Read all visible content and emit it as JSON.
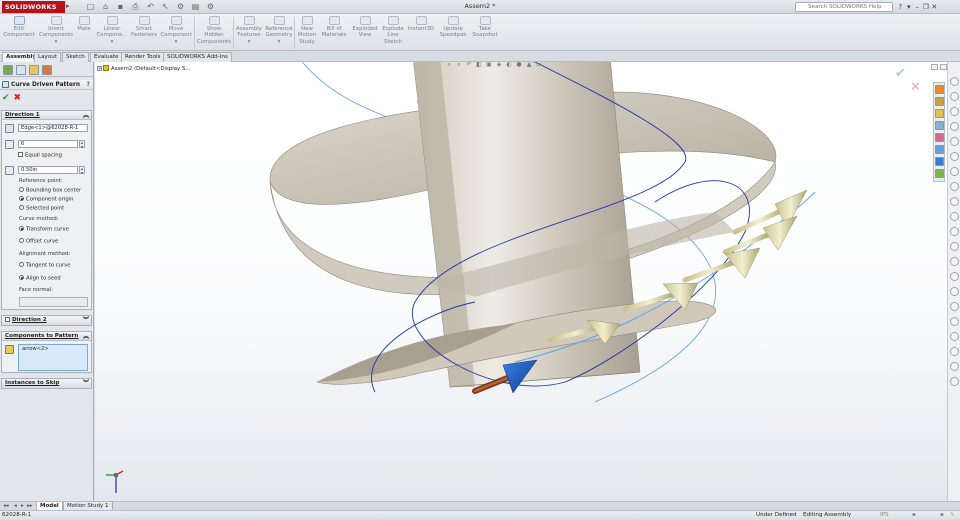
{
  "app": {
    "brand": "SOLIDWORKS",
    "document_title": "Assem2 *",
    "search_placeholder": "Search SOLIDWORKS Help",
    "accent": "#b5121b"
  },
  "ribbon": {
    "buttons": [
      {
        "label1": "Edit",
        "label2": "Component",
        "label3": ""
      },
      {
        "label1": "Insert",
        "label2": "Components",
        "label3": ""
      },
      {
        "label1": "Mate",
        "label2": "",
        "label3": ""
      },
      {
        "label1": "Linear",
        "label2": "Compone...",
        "label3": ""
      },
      {
        "label1": "Smart",
        "label2": "Fasteners",
        "label3": ""
      },
      {
        "label1": "Move",
        "label2": "Component",
        "label3": ""
      },
      {
        "label1": "Show",
        "label2": "Hidden",
        "label3": "Components"
      },
      {
        "label1": "Assembly",
        "label2": "Features",
        "label3": ""
      },
      {
        "label1": "Reference",
        "label2": "Geometry",
        "label3": ""
      },
      {
        "label1": "New",
        "label2": "Motion",
        "label3": "Study"
      },
      {
        "label1": "Bill of",
        "label2": "Materials",
        "label3": ""
      },
      {
        "label1": "Exploded",
        "label2": "View",
        "label3": ""
      },
      {
        "label1": "Explode",
        "label2": "Line",
        "label3": "Sketch"
      },
      {
        "label1": "Instant3D",
        "label2": "",
        "label3": ""
      },
      {
        "label1": "Update",
        "label2": "Speedpak",
        "label3": ""
      },
      {
        "label1": "Take",
        "label2": "Snapshot",
        "label3": ""
      }
    ]
  },
  "tabs": [
    "Assembly",
    "Layout",
    "Sketch",
    "Evaluate",
    "Render Tools",
    "SOLIDWORKS Add-Ins"
  ],
  "property_manager": {
    "title": "Curve Driven Pattern",
    "direction1": {
      "header": "Direction 1",
      "edge": "Edge<1>@62028-R-1",
      "instances": "6",
      "equal_spacing": "Equal spacing",
      "spacing": "0.50in",
      "reference_point_label": "Reference point:",
      "reference_options": [
        "Bounding box center",
        "Component origin",
        "Selected point"
      ],
      "reference_selected": 1,
      "curve_method_label": "Curve method:",
      "curve_options": [
        "Transform curve",
        "Offset curve"
      ],
      "curve_selected": 0,
      "alignment_label": "Alignment method:",
      "alignment_options": [
        "Tangent to curve",
        "Align to seed"
      ],
      "alignment_selected": 1,
      "face_normal_label": "Face normal:"
    },
    "direction2": {
      "header": "Direction 2"
    },
    "components": {
      "header": "Components to Pattern",
      "items": [
        "arrow<2>"
      ]
    },
    "instances_to_skip": {
      "header": "Instances to Skip"
    }
  },
  "viewport": {
    "tree_item": "Assem2  (Default<Display S..."
  },
  "model_tabs": [
    "Model",
    "Motion Study 1"
  ],
  "status": {
    "left": "62028-R-1",
    "state": "Under Defined",
    "mode": "Editing Assembly",
    "units": "IPS"
  }
}
